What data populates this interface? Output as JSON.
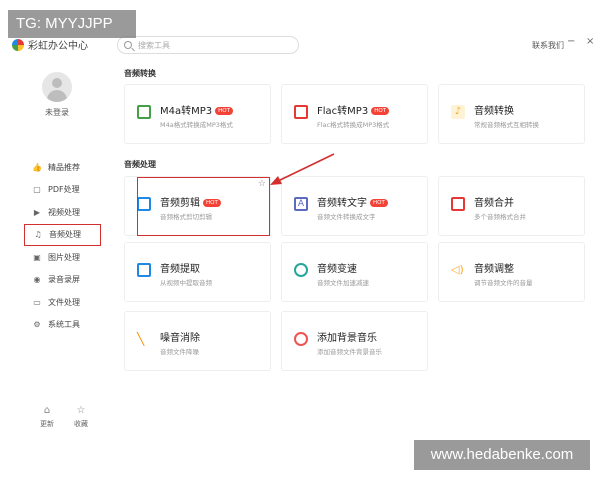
{
  "watermarks": {
    "top": "TG: MYYJJPP",
    "bottom": "www.hedabenke.com"
  },
  "app": {
    "logo_text": "彩虹办公中心"
  },
  "search": {
    "placeholder": "搜索工具"
  },
  "topbar": {
    "contact": "联系我们",
    "minimize": "−",
    "close": "×"
  },
  "sidebar": {
    "login_status": "未登录",
    "items": [
      {
        "label": "精品推荐",
        "icon": "thumb-icon"
      },
      {
        "label": "PDF处理",
        "icon": "pdf-icon"
      },
      {
        "label": "视频处理",
        "icon": "video-icon"
      },
      {
        "label": "音频处理",
        "icon": "music-icon",
        "active": true
      },
      {
        "label": "图片处理",
        "icon": "image-icon"
      },
      {
        "label": "录音录屏",
        "icon": "record-icon"
      },
      {
        "label": "文件处理",
        "icon": "folder-icon"
      },
      {
        "label": "系统工具",
        "icon": "system-icon"
      }
    ],
    "bottom": {
      "update": "更新",
      "favorites": "收藏"
    }
  },
  "sections": {
    "convert": {
      "title": "音频转换",
      "cards": [
        {
          "title": "M4a转MP3",
          "hot": "HOT",
          "desc": "M4a格式转换成MP3格式",
          "color": "#43a047"
        },
        {
          "title": "Flac转MP3",
          "hot": "HOT",
          "desc": "Flac格式转换成MP3格式",
          "color": "#e53935"
        },
        {
          "title": "音频转换",
          "hot": "",
          "desc": "常规音频格式互相转换",
          "color": "#f9a825"
        }
      ]
    },
    "process": {
      "title": "音频处理",
      "cards": [
        {
          "title": "音频剪辑",
          "hot": "HOT",
          "desc": "音频格式剪切剪辑",
          "color": "#1e88e5"
        },
        {
          "title": "音频转文字",
          "hot": "HOT",
          "desc": "音频文件转换成文字",
          "color": "#5c6bc0"
        },
        {
          "title": "音频合并",
          "hot": "",
          "desc": "多个音频格式合并",
          "color": "#e53935"
        },
        {
          "title": "音频提取",
          "hot": "",
          "desc": "从视频中提取音频",
          "color": "#1e88e5"
        },
        {
          "title": "音频变速",
          "hot": "",
          "desc": "音频文件加速减速",
          "color": "#26a69a"
        },
        {
          "title": "音频调整",
          "hot": "",
          "desc": "调节音频文件的音量",
          "color": "#f9a825"
        },
        {
          "title": "噪音消除",
          "hot": "",
          "desc": "音频文件降噪",
          "color": "#fb8c00"
        },
        {
          "title": "添加背景音乐",
          "hot": "",
          "desc": "添加音频文件背景音乐",
          "color": "#ef5350"
        }
      ]
    }
  }
}
